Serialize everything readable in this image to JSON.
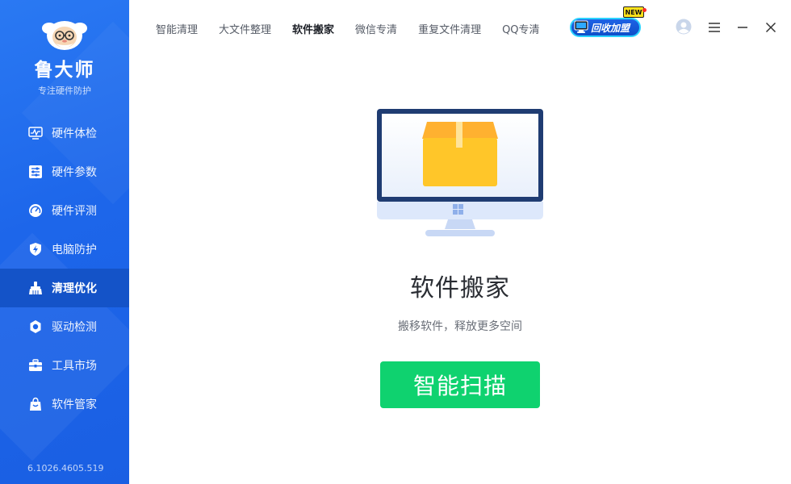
{
  "sidebar": {
    "brand_name": "鲁大师",
    "brand_slogan": "专注硬件防护",
    "items": [
      {
        "label": "硬件体检",
        "icon": "monitor-pulse-icon"
      },
      {
        "label": "硬件参数",
        "icon": "sliders-icon"
      },
      {
        "label": "硬件评测",
        "icon": "speedometer-icon"
      },
      {
        "label": "电脑防护",
        "icon": "shield-bolt-icon"
      },
      {
        "label": "清理优化",
        "icon": "broom-icon"
      },
      {
        "label": "驱动检测",
        "icon": "gear-icon"
      },
      {
        "label": "工具市场",
        "icon": "toolbox-icon"
      },
      {
        "label": "软件管家",
        "icon": "shopping-bag-icon"
      }
    ],
    "active_index": 4,
    "version": "6.1026.4605.519"
  },
  "topbar": {
    "tabs": [
      "智能清理",
      "大文件整理",
      "软件搬家",
      "微信专清",
      "重复文件清理",
      "QQ专清"
    ],
    "active_tab": 2,
    "promo_label": "回收加盟",
    "promo_badge": "NEW"
  },
  "main": {
    "title": "软件搬家",
    "subtitle": "搬移软件，释放更多空间",
    "scan_button": "智能扫描"
  },
  "colors": {
    "sidebar": "#1d66ea",
    "sidebar_active": "#1453c8",
    "scan_button": "#0fd26f",
    "box": "#ffc629"
  }
}
